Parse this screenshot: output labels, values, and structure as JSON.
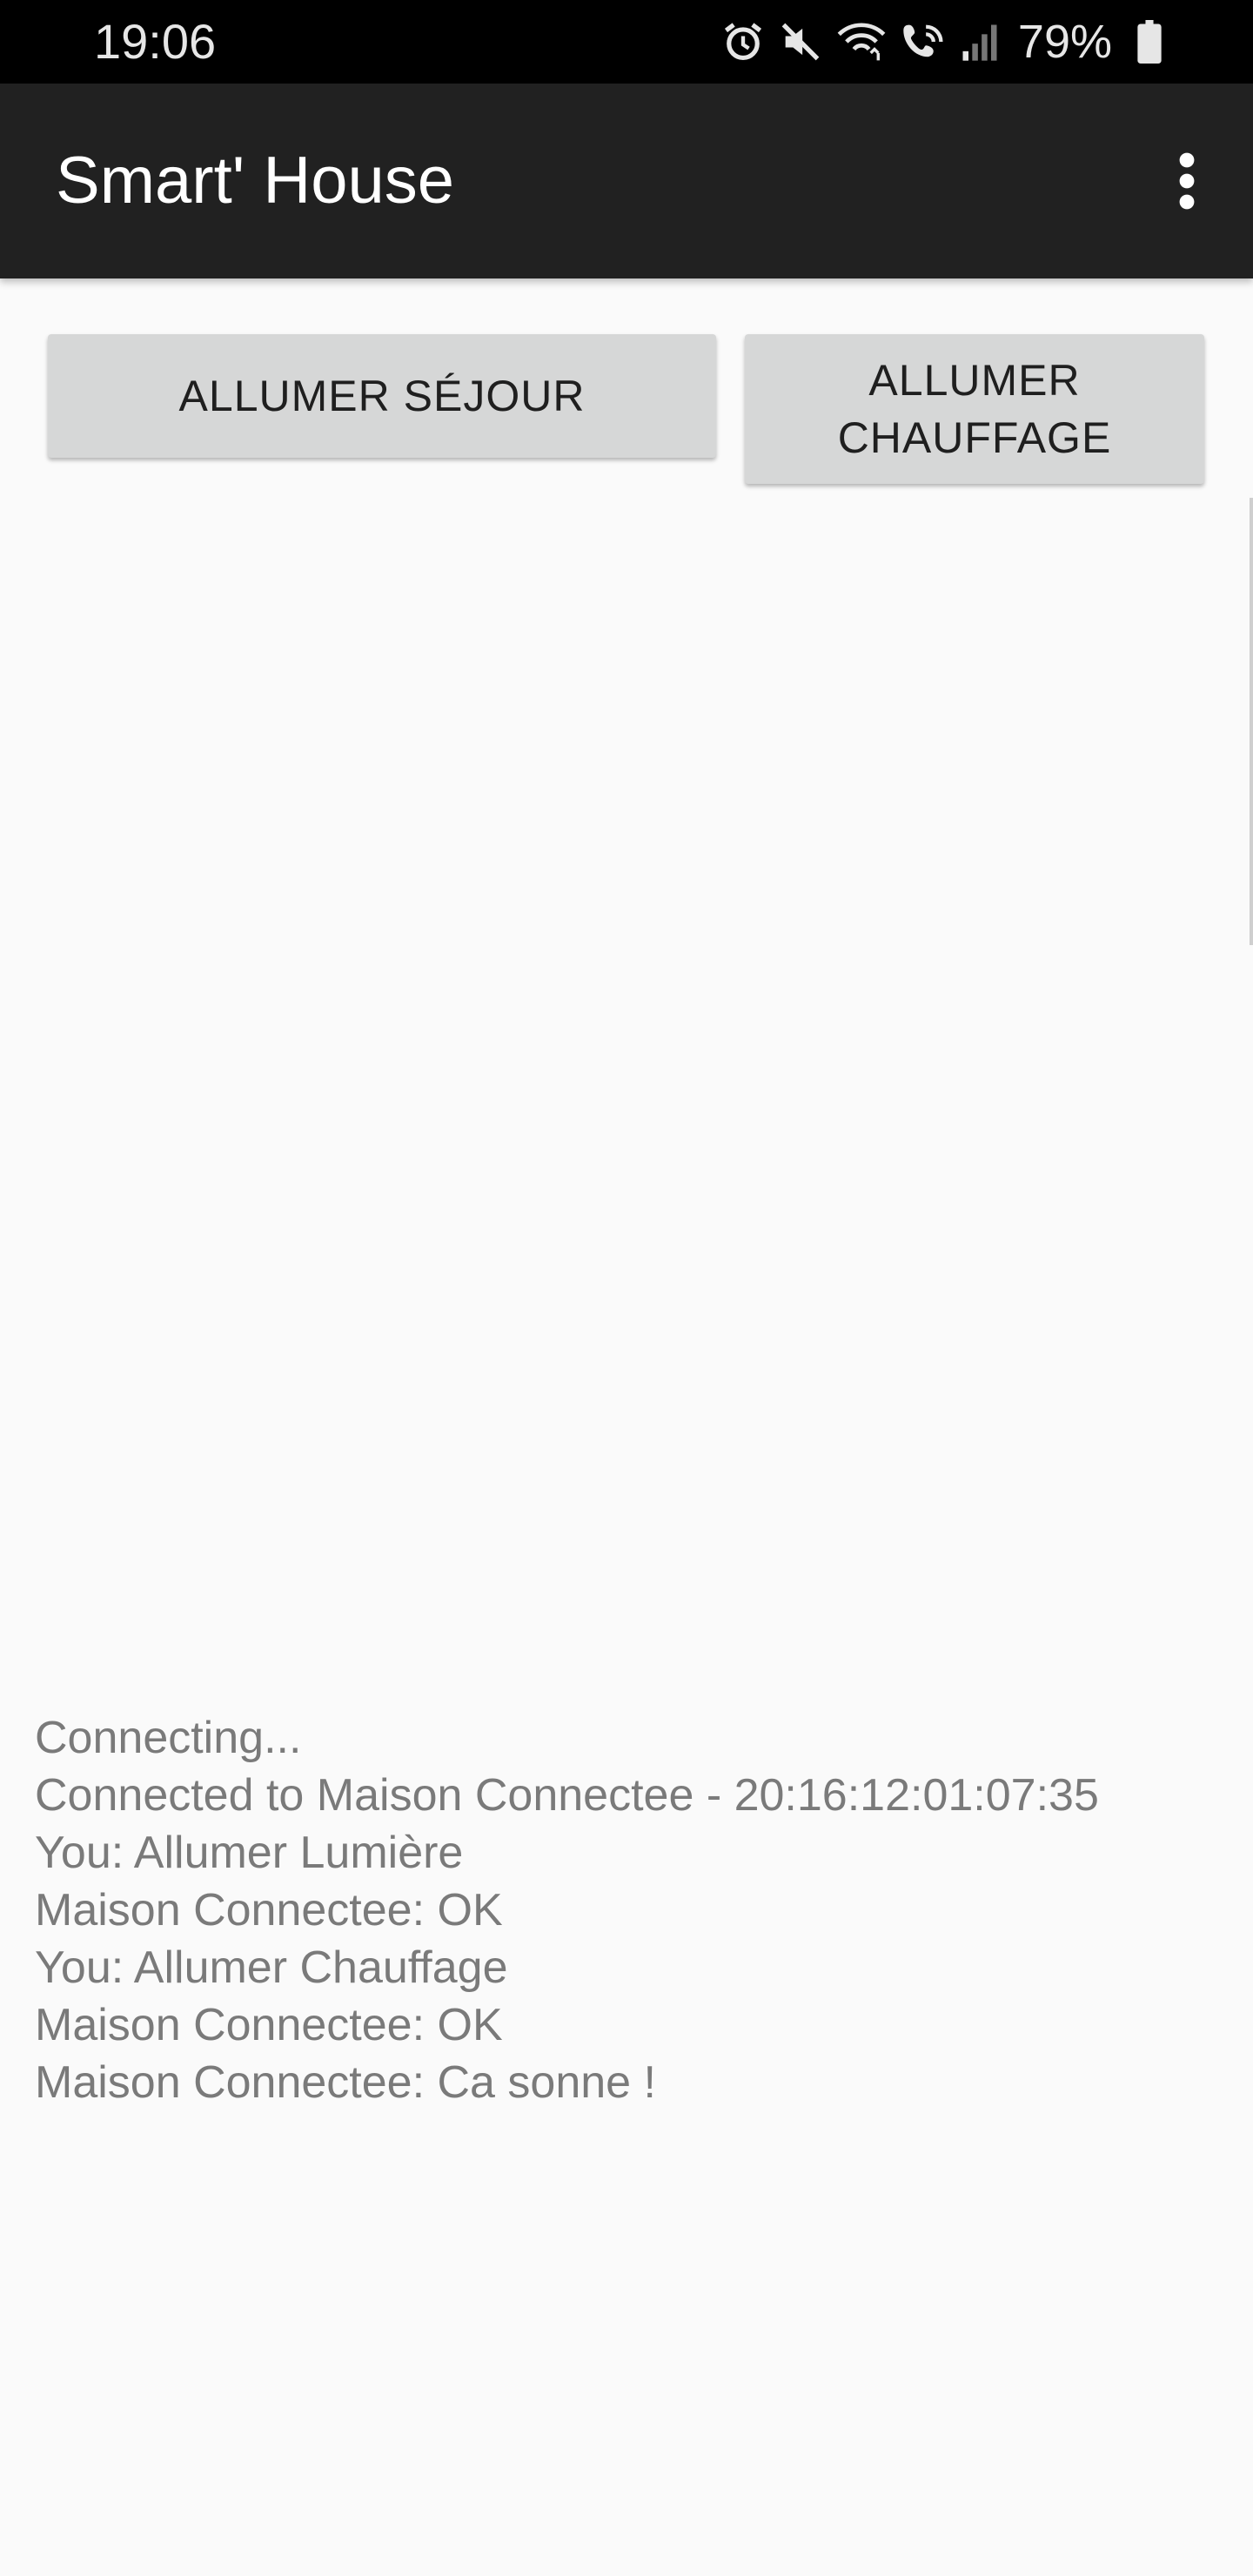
{
  "status_bar": {
    "time": "19:06",
    "battery_percent": "79%",
    "icons": [
      "alarm-icon",
      "mute-icon",
      "wifi-icon",
      "wifi-calling-icon",
      "signal-icon",
      "battery-icon"
    ]
  },
  "app_bar": {
    "title": "Smart' House",
    "menu_icon": "overflow-menu-icon"
  },
  "buttons": {
    "sejour_label": "ALLUMER SÉJOUR",
    "chauffage_label": "ALLUMER CHAUFFAGE"
  },
  "log": {
    "lines": [
      "Connecting...",
      "Connected to Maison Connectee - 20:16:12:01:07:35",
      "You: Allumer Lumière",
      "Maison Connectee: OK",
      "You: Allumer Chauffage",
      "Maison Connectee: OK",
      "Maison Connectee: Ca sonne !"
    ]
  },
  "colors": {
    "status_bar": "#000000",
    "app_bar": "#212121",
    "background": "#fafafa",
    "button": "#d6d7d7",
    "log_text": "#7a7a7a"
  }
}
